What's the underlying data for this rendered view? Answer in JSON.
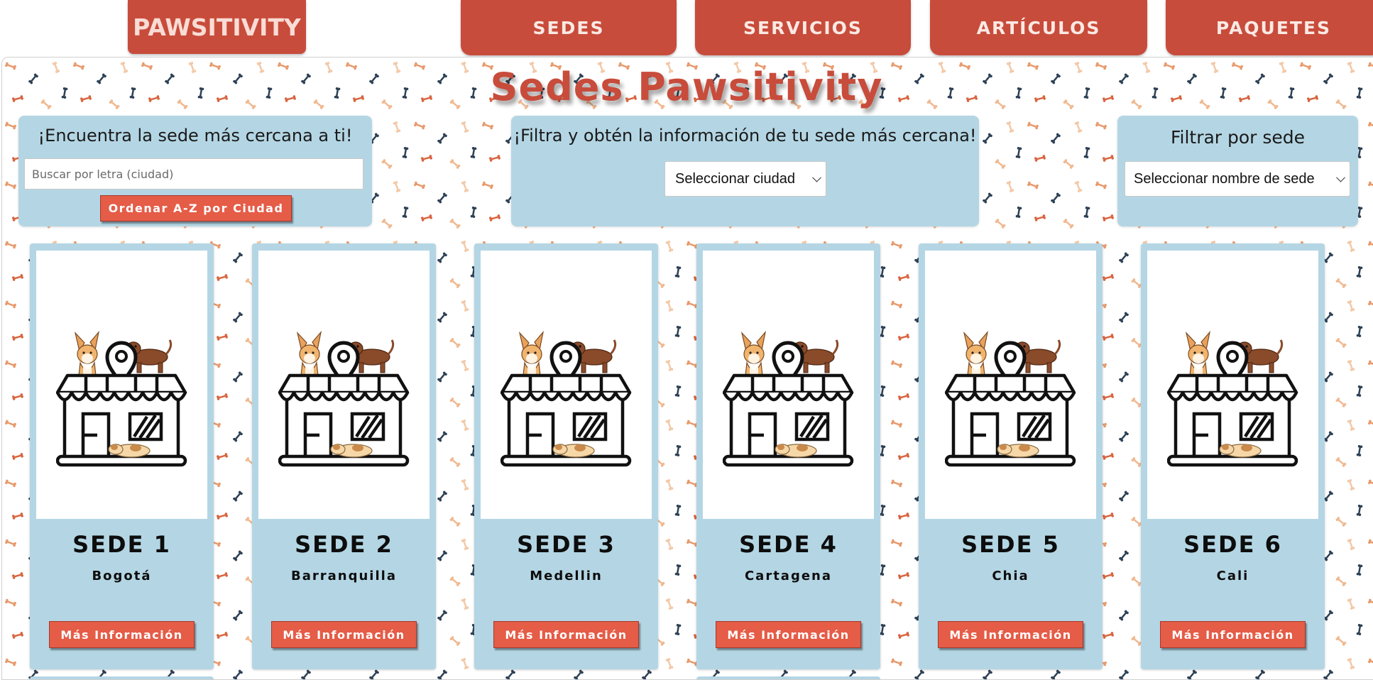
{
  "nav": {
    "logo": "PAWSITIVITY",
    "items": [
      "SEDES",
      "SERVICIOS",
      "ARTÍCULOS",
      "PAQUETES"
    ]
  },
  "page": {
    "title": "Sedes Pawsitivity"
  },
  "search_panel": {
    "title": "¡Encuentra la sede más cercana a ti!",
    "placeholder": "Buscar por letra (ciudad)",
    "sort_button": "Ordenar A-Z por Ciudad"
  },
  "filter_panel": {
    "title": "¡Filtra y obtén la información de tu sede más cercana!",
    "select_value": "Seleccionar ciudad"
  },
  "sede_panel": {
    "title": "Filtrar por sede",
    "select_value": "Seleccionar nombre de sede"
  },
  "cards": [
    {
      "title": "SEDE 1",
      "city": "Bogotá",
      "button": "Más Información"
    },
    {
      "title": "SEDE 2",
      "city": "Barranquilla",
      "button": "Más Información"
    },
    {
      "title": "SEDE 3",
      "city": "Medellin",
      "button": "Más Información"
    },
    {
      "title": "SEDE 4",
      "city": "Cartagena",
      "button": "Más Información"
    },
    {
      "title": "SEDE 5",
      "city": "Chia",
      "button": "Más Información"
    },
    {
      "title": "SEDE 6",
      "city": "Cali",
      "button": "Más Información"
    }
  ],
  "colors": {
    "brand_red": "#c84c3b",
    "button_red": "#e55c47",
    "panel_blue": "#b4d6e4"
  },
  "icons": {
    "card_image": "pet-store-location-illustration",
    "background_pattern": "bone-pattern"
  }
}
